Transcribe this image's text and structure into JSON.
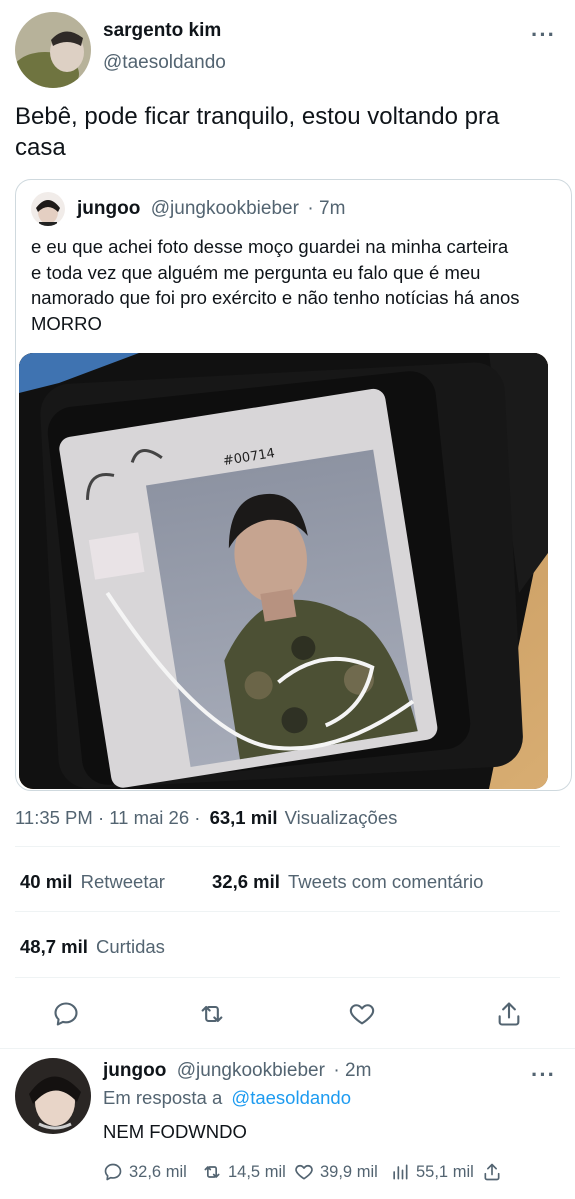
{
  "colors": {
    "accent": "#1d9bf0",
    "muted": "#536471",
    "text": "#0f1419",
    "border": "#cfd9de"
  },
  "main_tweet": {
    "name": "sargento kim",
    "handle": "@taesoldando",
    "text": "Bebê, pode ficar tranquilo, estou voltando pra casa"
  },
  "quote": {
    "name": "jungoo",
    "handle": "@jungkookbieber",
    "time": "· 7m",
    "text": "e eu que achei foto desse moço guardei na minha carteira e toda vez que alguém me pergunta eu falo que é meu namorado que foi pro exército e não tenho notícias há anos MORRO",
    "card_number": "#00714"
  },
  "meta": {
    "timestamp": "11:35 PM · 11 mai 26 ·",
    "views_value": "63,1 mil",
    "views_label": "Visualizações"
  },
  "stats": {
    "retweets_value": "40 mil",
    "retweets_label": "Retweetar",
    "quotes_value": "32,6 mil",
    "quotes_label": "Tweets com comentário",
    "likes_value": "48,7 mil",
    "likes_label": "Curtidas"
  },
  "reply": {
    "name": "jungoo",
    "handle": "@jungkookbieber",
    "time": "· 2m",
    "in_reply_prefix": "Em resposta a",
    "in_reply_handle": "@taesoldando",
    "text": "NEM FODWNDO",
    "replies": "32,6 mil",
    "retweets": "14,5 mil",
    "likes": "39,9 mil",
    "views": "55,1 mil"
  }
}
